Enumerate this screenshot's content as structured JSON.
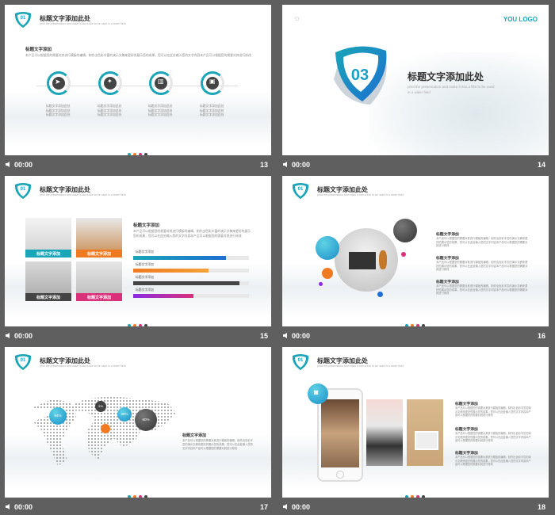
{
  "footer_time": "00:00",
  "colors": {
    "teal": "#1aa5b8",
    "blue": "#1d6fd0",
    "orange": "#f07a22",
    "pink": "#d9317a",
    "dark": "#444444"
  },
  "common": {
    "slide_title": "标题文字添加此处",
    "slide_sub": "print the presentation and make it into a film to be used in a wider field",
    "section_heading": "标题文字添加",
    "lorem": "本产品可以根据您的需要对其进行模板的编辑，制作出色彩丰富的演示文稿来更好的展示您的成果，您可以在此处输入您的文字内容本产品可以根据您的需要对其进行修改",
    "item_text": "标题文字添加此处"
  },
  "slides": [
    {
      "num": "13",
      "badge": "01"
    },
    {
      "num": "14",
      "logo": "YOU LOGO",
      "big_num": "03",
      "title": "标题文字添加此处",
      "sub": "print the presentation  and make it into a film to be used in a wider field"
    },
    {
      "num": "15",
      "badge": "01",
      "tiles": [
        "标题文字添加",
        "标题文字添加",
        "标题文字添加",
        "标题文字添加"
      ],
      "bars": [
        "标题文字添加",
        "标题文字添加",
        "标题文字添加",
        "标题文字添加"
      ]
    },
    {
      "num": "16",
      "badge": "01"
    },
    {
      "num": "17",
      "badge": "01",
      "bubbles": [
        "54%",
        "9%",
        "28%",
        "60%"
      ]
    },
    {
      "num": "18",
      "badge": "01"
    }
  ]
}
